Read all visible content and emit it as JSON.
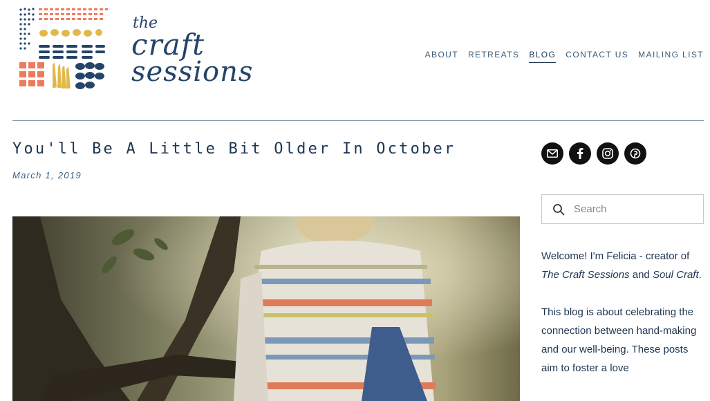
{
  "logo": {
    "the": "the",
    "craft": "craft",
    "sessions": "sessions",
    "colors": {
      "coral": "#ee7a5c",
      "mustard": "#e1b94b",
      "navy": "#24446a"
    }
  },
  "nav": {
    "items": [
      {
        "label": "ABOUT",
        "active": false
      },
      {
        "label": "RETREATS",
        "active": false
      },
      {
        "label": "BLOG",
        "active": true
      },
      {
        "label": "CONTACT US",
        "active": false
      },
      {
        "label": "MAILING LIST",
        "active": false
      }
    ]
  },
  "post": {
    "title": "You'll Be A Little Bit Older In October",
    "date": "March 1, 2019"
  },
  "sidebar": {
    "social_icons": [
      "email-icon",
      "facebook-icon",
      "instagram-icon",
      "pinterest-icon"
    ],
    "search": {
      "placeholder": "Search",
      "value": ""
    },
    "welcome": {
      "pre": "Welcome! I'm Felicia - creator of ",
      "em1": "The Craft Sessions",
      "mid": " and ",
      "em2": "Soul Craft",
      "post": "."
    },
    "about_text": "This blog is about celebrating the connection between hand-making and our well-being. These posts aim to foster a love"
  }
}
